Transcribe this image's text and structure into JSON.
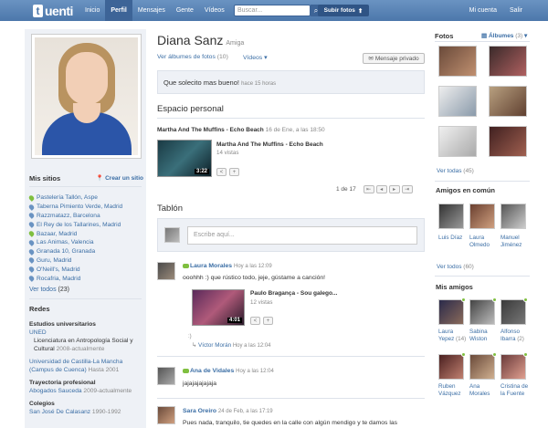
{
  "brand": {
    "logo_letter": "t",
    "logo_word": "uenti"
  },
  "nav": {
    "items": [
      "Inicio",
      "Perfil",
      "Mensajes",
      "Gente",
      "Vídeos"
    ],
    "active": "Perfil"
  },
  "search": {
    "placeholder": "Buscar..."
  },
  "upload": {
    "label": "Subir fotos"
  },
  "right_nav": {
    "account": "Mi cuenta",
    "logout": "Salir"
  },
  "profile": {
    "name": "Diana Sanz",
    "relation": "Amiga"
  },
  "profile_links": {
    "albums": "Ver álbumes de fotos",
    "albums_count": "(10)",
    "videos": "Vídeos",
    "message": "Mensaje privado"
  },
  "status": {
    "text": "Que solecito mas bueno!",
    "time": "hace 15 horas"
  },
  "personal_space": {
    "title": "Espacio personal",
    "post_title": "Martha And The Muffins - Echo Beach",
    "post_date": "16 de Ene, a las 18:50",
    "video_title": "Martha And The Muffins - Echo Beach",
    "views": "14 vistas",
    "duration": "3:22"
  },
  "pager": {
    "label": "1 de 17"
  },
  "board": {
    "title": "Tablón",
    "placeholder": "Escribe aquí..."
  },
  "posts": [
    {
      "author": "Laura Morales",
      "time": "Hoy a las 12:09",
      "text": "ooohhh :) que rústico todo, jeje, gústame a canción!",
      "video_title": "Paulo Bragança - Sou galego...",
      "views": "12 vistas",
      "duration": "4:01",
      "reply_author": "Víctor Morán",
      "reply_time": "Hoy a las 12:04"
    },
    {
      "author": "Ana de Vidales",
      "time": "Hoy a las 12:04",
      "text": "jajajajajajaja"
    },
    {
      "author": "Sara Oreiro",
      "time": "24 de Feb, a las 17:19",
      "text": "Pues nada, tranquilo, tie quedes en la calle con algún mendigo y te damos las"
    }
  ],
  "my_sites": {
    "title": "Mis sitios",
    "create": "Crear un sitio",
    "items": [
      "Pastelería Tallón, Aspe",
      "Taberna Pimiento Verde, Madrid",
      "Razzmatazz, Barcelona",
      "El Rey de los Tallarines, Madrid",
      "Bazaar, Madrid",
      "Las Animas, Valencia",
      "Granada 10, Granada",
      "Guru, Madrid",
      "O'Neill's, Madrid",
      "Rocafria, Madrid"
    ],
    "green_flags": [
      true,
      false,
      false,
      false,
      true,
      false,
      false,
      false,
      false,
      false
    ],
    "see_all": "Ver todos",
    "see_all_count": "(23)"
  },
  "networks": {
    "title": "Redes",
    "univ_title": "Estudios universitarios",
    "univ1": "UNED",
    "univ1_detail": "Licenciatura en Antropología Social y Cultural",
    "univ1_years": "2008-actualmente",
    "univ2": "Universidad de Castilla-La Mancha (Campus de Cuenca)",
    "univ2_years": "Hasta 2001",
    "work_title": "Trayectoria profesional",
    "work1": "Abogados Sauceda",
    "work1_years": "2009-actualmente",
    "school_title": "Colegios",
    "school1": "San José De Calasanz",
    "school1_years": "1990-1992"
  },
  "photos": {
    "title": "Fotos",
    "albums": "Álbumes",
    "albums_count": "(3)",
    "see_all": "Ver todas",
    "see_all_count": "(45)"
  },
  "common_friends": {
    "title": "Amigos en común",
    "items": [
      "Luis Díaz",
      "Laura Olmedo",
      "Manuel Jiménez"
    ],
    "see_all": "Ver todos",
    "see_all_count": "(60)"
  },
  "my_friends": {
    "title": "Mis amigos",
    "items": [
      "Laura Yepez",
      "Sabina Wiston",
      "Alfonso Ibarra",
      "Ruben Vázquez",
      "Ana Morales",
      "Cristina de la Fuente"
    ],
    "counts": [
      "(14)",
      "",
      "(2)",
      "",
      "",
      ""
    ]
  }
}
